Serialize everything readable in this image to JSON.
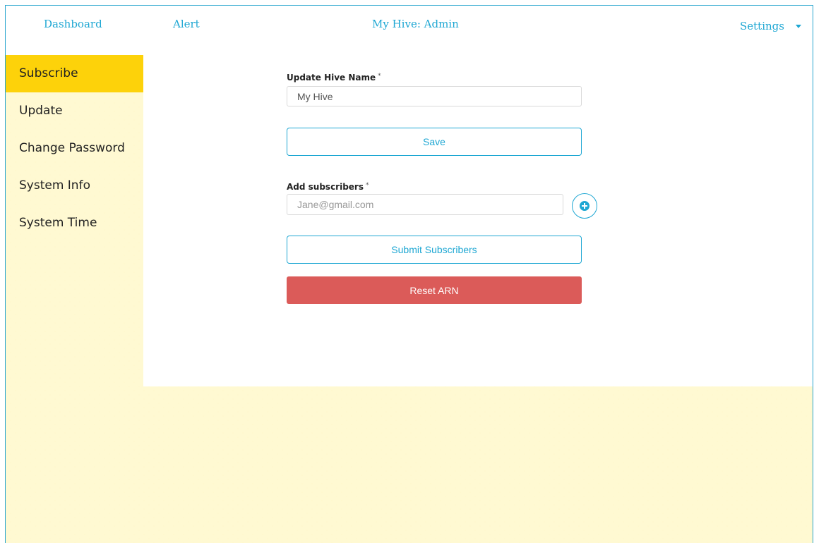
{
  "nav": {
    "dashboard": "Dashboard",
    "alert": "Alert",
    "title": "My Hive: Admin",
    "settings": "Settings"
  },
  "sidebar": {
    "items": [
      {
        "label": "Subscribe",
        "active": true
      },
      {
        "label": "Update",
        "active": false
      },
      {
        "label": "Change Password",
        "active": false
      },
      {
        "label": "System Info",
        "active": false
      },
      {
        "label": "System Time",
        "active": false
      }
    ]
  },
  "form": {
    "hive_name_label": "Update Hive Name",
    "hive_name_required": "*",
    "hive_name_value": "My Hive",
    "save_label": "Save",
    "subscribers_label": "Add subscribers",
    "subscribers_required": "*",
    "subscribers_placeholder": "Jane@gmail.com",
    "submit_label": "Submit Subscribers",
    "reset_label": "Reset ARN"
  },
  "icons": {
    "add": "plus-circle-icon",
    "settings_caret": "caret-down-icon"
  },
  "colors": {
    "accent": "#1ea7d3",
    "active_tab": "#fdd20a",
    "danger": "#db5b59",
    "honeycomb": "#fdf3b0"
  }
}
